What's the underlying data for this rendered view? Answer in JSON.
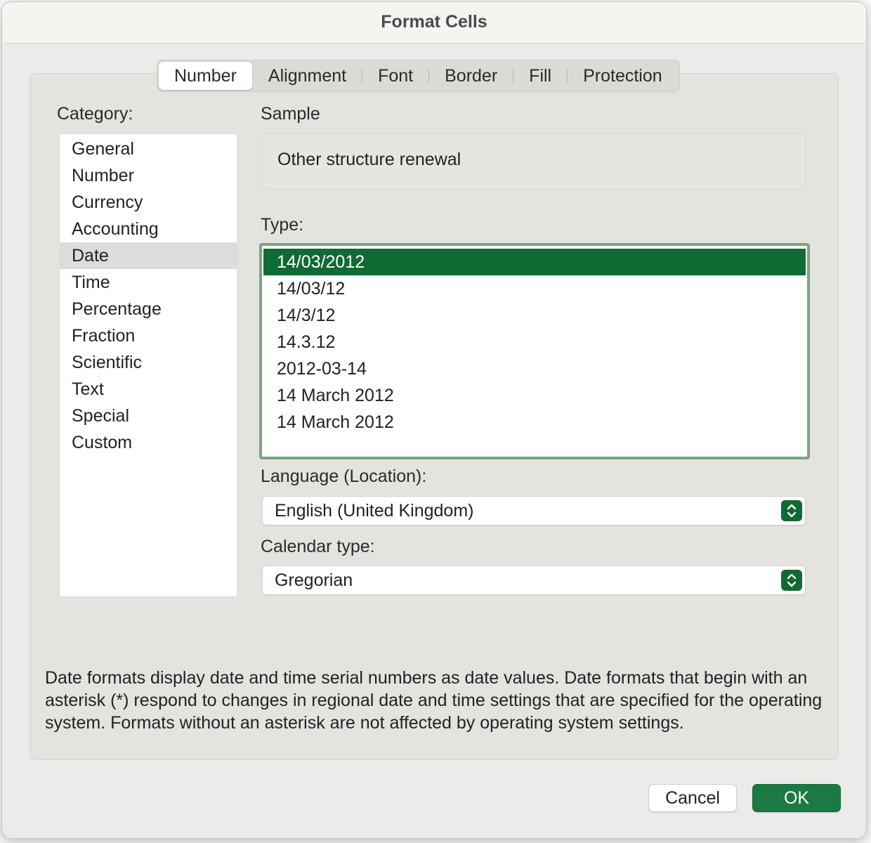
{
  "dialog": {
    "title": "Format Cells"
  },
  "tabs": [
    {
      "label": "Number",
      "selected": true
    },
    {
      "label": "Alignment",
      "selected": false
    },
    {
      "label": "Font",
      "selected": false
    },
    {
      "label": "Border",
      "selected": false
    },
    {
      "label": "Fill",
      "selected": false
    },
    {
      "label": "Protection",
      "selected": false
    }
  ],
  "category": {
    "label": "Category:",
    "selected": "Date",
    "items": [
      "General",
      "Number",
      "Currency",
      "Accounting",
      "Date",
      "Time",
      "Percentage",
      "Fraction",
      "Scientific",
      "Text",
      "Special",
      "Custom"
    ]
  },
  "sample": {
    "label": "Sample",
    "value": "Other structure renewal"
  },
  "type": {
    "label": "Type:",
    "selected_index": 0,
    "items": [
      "14/03/2012",
      "14/03/12",
      "14/3/12",
      "14.3.12",
      "2012-03-14",
      "14 March 2012",
      "14 March 2012"
    ]
  },
  "language": {
    "label": "Language (Location):",
    "value": "English (United Kingdom)"
  },
  "calendar": {
    "label": "Calendar type:",
    "value": "Gregorian"
  },
  "description": "Date formats display date and time serial numbers as date values.  Date formats that begin with an asterisk (*) respond to changes in regional date and time settings that are specified for the operating system. Formats without an asterisk are not affected by operating system settings.",
  "buttons": {
    "cancel": "Cancel",
    "ok": "OK"
  },
  "colors": {
    "accent": "#106b33",
    "selection_border": "#77a683",
    "ok_button": "#1a7a42"
  },
  "icons": {
    "popup_stepper": "up-down-chevron-icon"
  }
}
